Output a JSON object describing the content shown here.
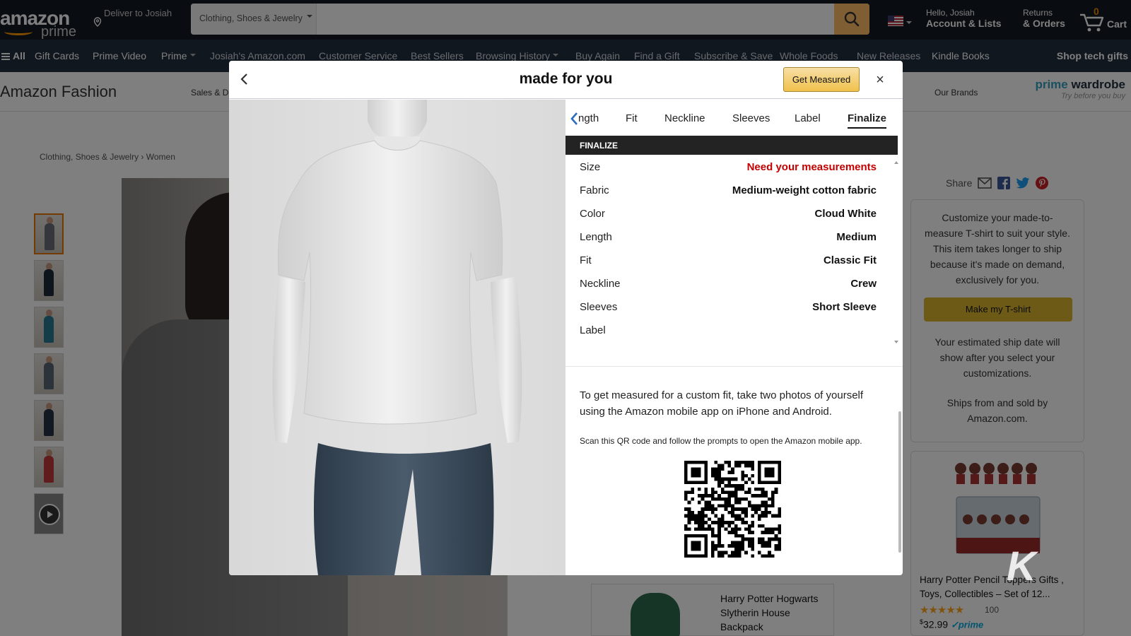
{
  "header": {
    "logo_word": "amazon",
    "logo_sub": "prime",
    "deliver_to": "Deliver to Josiah",
    "search_category": "Clothing, Shoes & Jewelry",
    "search_value": "",
    "greeting": "Hello, Josiah",
    "account_label": "Account & Lists",
    "returns_label": "Returns",
    "orders_label": "& Orders",
    "cart_count": "0",
    "cart_label": "Cart"
  },
  "nav": {
    "all": "All",
    "items": [
      "Gift Cards",
      "Prime Video",
      "Prime",
      "Josiah's Amazon.com",
      "Customer Service",
      "Best Sellers",
      "Browsing History",
      "Buy Again",
      "Find a Gift",
      "Subscribe & Save",
      "Whole Foods",
      "New Releases",
      "Kindle Books"
    ],
    "shop_tech": "Shop tech gifts"
  },
  "subheader": {
    "brand": "Amazon Fashion",
    "sales": "Sales & D",
    "our_brands": "Our Brands",
    "prime_wardrobe_a": "prime",
    "prime_wardrobe_b": "wardrobe",
    "prime_wardrobe_tag": "Try before you buy"
  },
  "breadcrumb": [
    "Clothing, Shoes & Jewelry",
    "Women"
  ],
  "share": {
    "label": "Share"
  },
  "buybox": {
    "text": "Customize your made-to-measure T-shirt to suit your style. This item takes longer to ship because it's made on demand, exclusively for you.",
    "button": "Make my T-shirt",
    "ship_text": "Your estimated ship date will show after you select your customizations.",
    "sold_by": "Ships from and sold by Amazon.com."
  },
  "ad": {
    "title": "Harry Potter Pencil Toppers Gifts , Toys, Collectibles – Set of 12...",
    "stars": "★★★★★",
    "rating_count": "100",
    "price_dollars": "32",
    "price_cents": "99",
    "prime": "prime"
  },
  "backpack": {
    "title": "Harry Potter Hogwarts Slytherin House Backpack"
  },
  "modal": {
    "title": "made for you",
    "get_measured": "Get Measured",
    "close": "×",
    "tabs": [
      "ngth",
      "Fit",
      "Neckline",
      "Sleeves",
      "Label",
      "Finalize"
    ],
    "active_tab": "Finalize",
    "section": "FINALIZE",
    "rows": [
      {
        "label": "Size",
        "value": "Need your measurements"
      },
      {
        "label": "Fabric",
        "value": "Medium-weight cotton fabric"
      },
      {
        "label": "Color",
        "value": "Cloud White"
      },
      {
        "label": "Length",
        "value": "Medium"
      },
      {
        "label": "Fit",
        "value": "Classic Fit"
      },
      {
        "label": "Neckline",
        "value": "Crew"
      },
      {
        "label": "Sleeves",
        "value": "Short Sleeve"
      },
      {
        "label": "Label",
        "value": ""
      }
    ],
    "info": "To get measured for a custom fit, take two photos of yourself using the Amazon mobile app on iPhone and Android.",
    "scan": "Scan this QR code and follow the prompts to open the Amazon mobile app."
  },
  "watermark": "K",
  "colors": {
    "topbar": "#131921",
    "navbar": "#232f3e",
    "accent": "#ff9900",
    "warning": "#c40000",
    "search_button": "#febd69"
  }
}
